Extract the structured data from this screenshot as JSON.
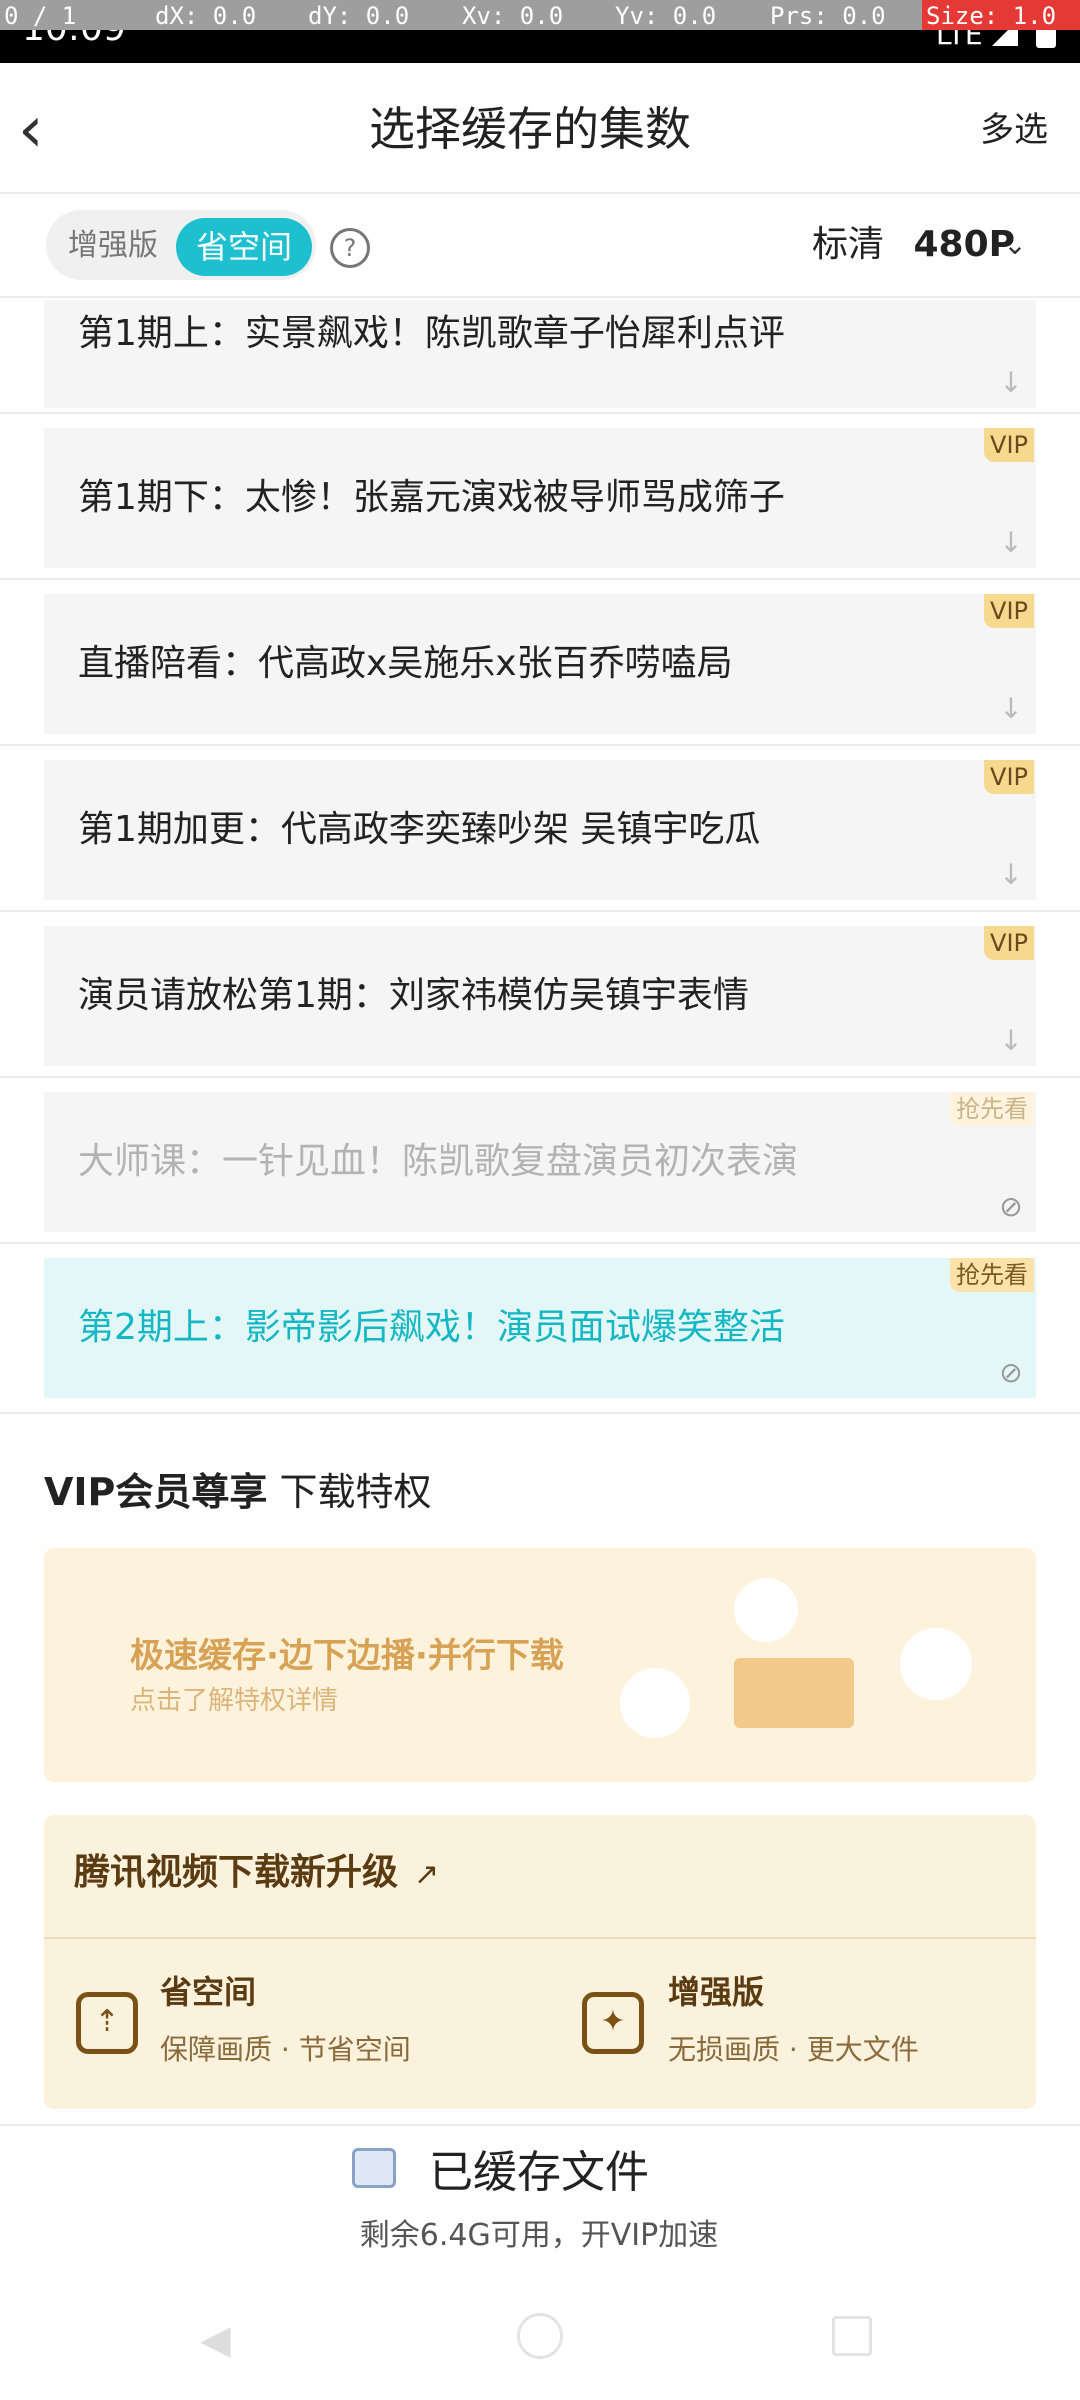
{
  "status_bar": {
    "time": "10:09",
    "network": "LTE",
    "dev_overlay": [
      "0 / 1",
      "dX: 0.0",
      "dY: 0.0",
      "Xv: 0.0",
      "Yv: 0.0",
      "Prs: 0.0",
      "Size: 1.0"
    ]
  },
  "header": {
    "back_icon": "chevron-left-icon",
    "title": "选择缓存的集数",
    "multi_select": "多选"
  },
  "options": {
    "mode_enhanced": "增强版",
    "mode_save_space": "省空间",
    "selected_mode": "省空间",
    "help_icon": "question-circle-icon",
    "quality_label": "标清",
    "quality_value": "480P",
    "quality_chevron": "chevron-down-icon"
  },
  "episodes": [
    {
      "title": "第1期上：实景飙戏！陈凯歌章子怡犀利点评",
      "badge": "",
      "status_icon": "download-arrow-icon"
    },
    {
      "title": "第1期下：太惨！张嘉元演戏被导师骂成筛子",
      "badge": "VIP",
      "status_icon": "download-arrow-icon"
    },
    {
      "title": "直播陪看：代高政x吴施乐x张百乔唠嗑局",
      "badge": "VIP",
      "status_icon": "download-arrow-icon"
    },
    {
      "title": "第1期加更：代高政李奕臻吵架 吴镇宇吃瓜",
      "badge": "VIP",
      "status_icon": "download-arrow-icon"
    },
    {
      "title": "演员请放松第1期：刘家祎模仿吴镇宇表情",
      "badge": "VIP",
      "status_icon": "download-arrow-icon"
    },
    {
      "title": "大师课：一针见血！陈凯歌复盘演员初次表演",
      "badge": "抢先看",
      "status_icon": "prohibited-icon"
    },
    {
      "title": "第2期上：影帝影后飙戏！演员面试爆笑整活",
      "badge": "抢先看",
      "status_icon": "prohibited-icon"
    }
  ],
  "vip_section": {
    "heading_bold": "VIP会员尊享",
    "heading_rest": " 下载特权",
    "banner_title": "极速缓存·边下边播·并行下载",
    "banner_subtitle": "点击了解特权详情"
  },
  "upgrade": {
    "title": "腾讯视频下载新升级",
    "arrow_icon": "arrow-right-icon",
    "mode1_icon": "save-space-icon",
    "mode1_name": "省空间",
    "mode1_desc": "保障画质 · 节省空间",
    "mode2_icon": "enhanced-icon",
    "mode2_name": "增强版",
    "mode2_desc": "无损画质 · 更大文件"
  },
  "footer": {
    "folder_icon": "folder-icon",
    "cached_files": "已缓存文件",
    "storage_info": "剩余6.4G可用，开VIP加速"
  },
  "colors": {
    "accent": "#1ec0cf",
    "vip_badge": "#f6d88f",
    "banner_bg": "#fdf3dc",
    "upgrade_text": "#5b3b12"
  }
}
